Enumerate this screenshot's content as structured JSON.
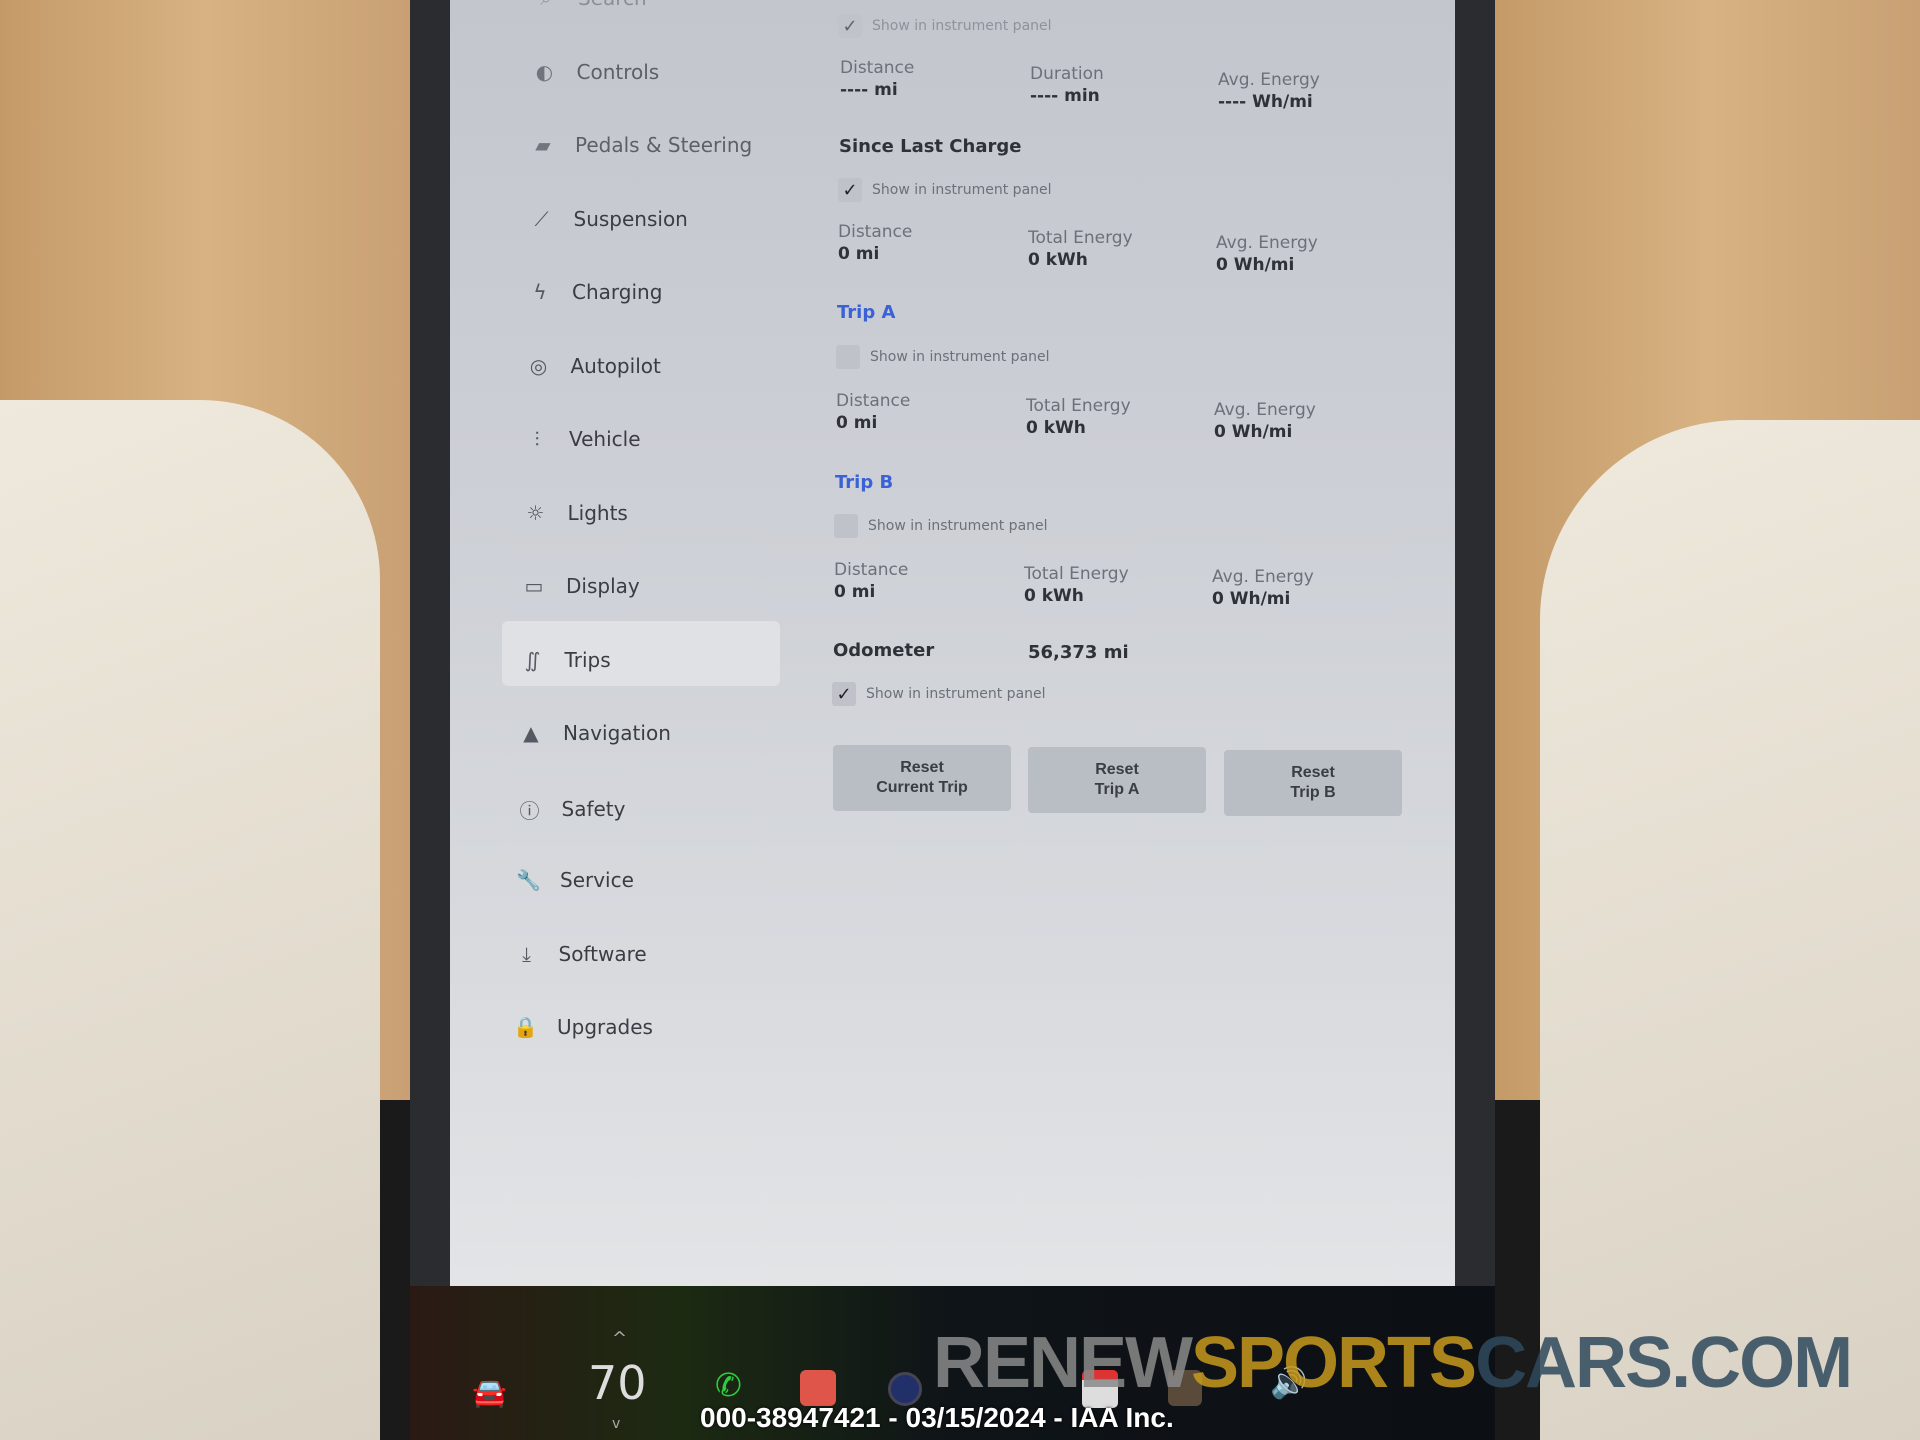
{
  "sidebar": {
    "items": [
      {
        "label": "Search",
        "icon": "search-icon"
      },
      {
        "label": "Controls",
        "icon": "toggle-icon"
      },
      {
        "label": "Pedals & Steering",
        "icon": "car-icon"
      },
      {
        "label": "Suspension",
        "icon": "suspension-icon"
      },
      {
        "label": "Charging",
        "icon": "bolt-icon"
      },
      {
        "label": "Autopilot",
        "icon": "steering-wheel-icon"
      },
      {
        "label": "Vehicle",
        "icon": "sliders-icon"
      },
      {
        "label": "Lights",
        "icon": "sun-icon"
      },
      {
        "label": "Display",
        "icon": "display-icon"
      },
      {
        "label": "Trips",
        "icon": "trips-icon",
        "selected": true
      },
      {
        "label": "Navigation",
        "icon": "navigation-arrow-icon"
      },
      {
        "label": "Safety",
        "icon": "info-circle-icon"
      },
      {
        "label": "Service",
        "icon": "wrench-icon"
      },
      {
        "label": "Software",
        "icon": "download-icon"
      },
      {
        "label": "Upgrades",
        "icon": "lock-icon"
      }
    ]
  },
  "trips": {
    "show_label": "Show in instrument panel",
    "current": {
      "checked": true,
      "distance_label": "Distance",
      "distance": "---- mi",
      "duration_label": "Duration",
      "duration": "---- min",
      "avg_label": "Avg. Energy",
      "avg": "---- Wh/mi"
    },
    "since_last_charge": {
      "title": "Since Last Charge",
      "checked": true,
      "distance_label": "Distance",
      "distance": "0 mi",
      "energy_label": "Total Energy",
      "energy": "0 kWh",
      "avg_label": "Avg. Energy",
      "avg": "0 Wh/mi"
    },
    "trip_a": {
      "title": "Trip A",
      "checked": false,
      "distance_label": "Distance",
      "distance": "0 mi",
      "energy_label": "Total Energy",
      "energy": "0 kWh",
      "avg_label": "Avg. Energy",
      "avg": "0 Wh/mi"
    },
    "trip_b": {
      "title": "Trip B",
      "checked": false,
      "distance_label": "Distance",
      "distance": "0 mi",
      "energy_label": "Total Energy",
      "energy": "0 kWh",
      "avg_label": "Avg. Energy",
      "avg": "0 Wh/mi"
    },
    "odometer": {
      "label": "Odometer",
      "value": "56,373 mi",
      "checked": true
    },
    "buttons": [
      {
        "l1": "Reset",
        "l2": "Current Trip"
      },
      {
        "l1": "Reset",
        "l2": "Trip A"
      },
      {
        "l1": "Reset",
        "l2": "Trip B"
      }
    ]
  },
  "taskbar": {
    "temperature": "70",
    "chevron_up": "^",
    "chevron_down": "v"
  },
  "watermark": {
    "part1": "RENEW",
    "part2": "SPORTS",
    "part3": "CARS.COM"
  },
  "caption": "000-38947421 - 03/15/2024 - IAA Inc.",
  "colors": {
    "accent": "#3a62d6",
    "watermark_gray": "#8a8a8a",
    "watermark_gold": "#c79a1e",
    "watermark_blue": "#2f4a5e"
  }
}
